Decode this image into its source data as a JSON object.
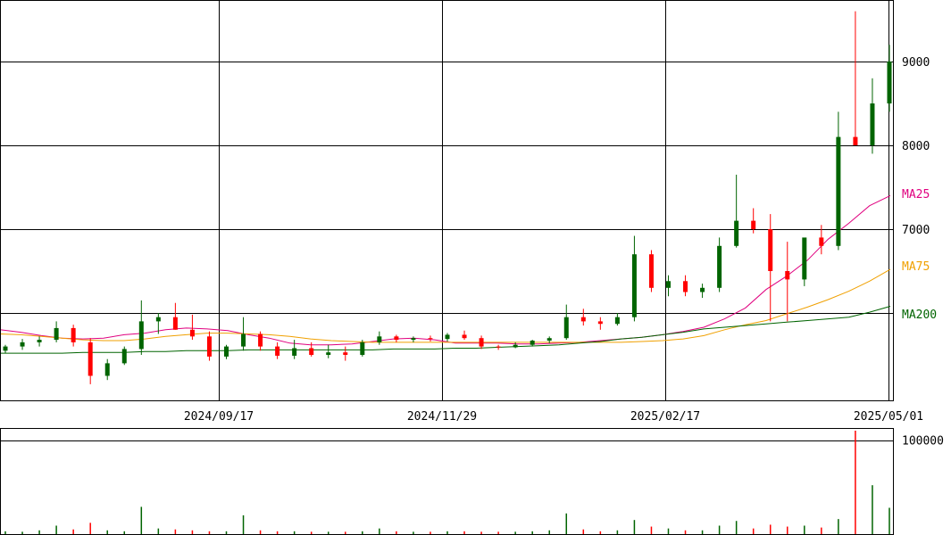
{
  "chart_data": {
    "type": "candlestick",
    "x_ticks": [
      "2024/09/17",
      "2024/11/29",
      "2025/02/17",
      "2025/05/01"
    ],
    "price_ticks": [
      9000,
      8000,
      7000
    ],
    "volume_ticks": [
      100000
    ],
    "ylim": [
      5000,
      10000
    ],
    "volume_ylim": [
      0,
      110000
    ],
    "grid": true,
    "colors": {
      "up": "#006400",
      "down": "#ff0000",
      "ma25": "#e0007f",
      "ma75": "#f0a000",
      "ma200": "#006400"
    },
    "moving_averages": [
      {
        "name": "MA25",
        "color": "#e0007f",
        "values": [
          5800,
          5770,
          5730,
          5700,
          5690,
          5700,
          5740,
          5760,
          5800,
          5820,
          5810,
          5790,
          5740,
          5700,
          5640,
          5620,
          5620,
          5630,
          5660,
          5690,
          5700,
          5680,
          5640,
          5640,
          5640,
          5630,
          5630,
          5640,
          5650,
          5670,
          5690,
          5710,
          5740,
          5780,
          5830,
          5930,
          6060,
          6280,
          6440,
          6630,
          6880,
          7070,
          7280,
          7400
        ]
      },
      {
        "name": "MA75",
        "color": "#f0a000",
        "values": [
          5750,
          5740,
          5720,
          5700,
          5680,
          5670,
          5670,
          5690,
          5720,
          5740,
          5760,
          5760,
          5750,
          5740,
          5720,
          5690,
          5670,
          5660,
          5650,
          5650,
          5650,
          5650,
          5650,
          5650,
          5650,
          5650,
          5650,
          5650,
          5650,
          5650,
          5650,
          5660,
          5670,
          5690,
          5730,
          5800,
          5860,
          5910,
          5990,
          6070,
          6160,
          6260,
          6380,
          6520
        ]
      },
      {
        "name": "MA200",
        "color": "#006400",
        "values": [
          5520,
          5520,
          5520,
          5520,
          5530,
          5530,
          5530,
          5540,
          5540,
          5550,
          5550,
          5550,
          5560,
          5560,
          5560,
          5560,
          5560,
          5560,
          5560,
          5570,
          5570,
          5570,
          5580,
          5580,
          5590,
          5600,
          5610,
          5620,
          5640,
          5660,
          5690,
          5710,
          5740,
          5770,
          5810,
          5830,
          5850,
          5870,
          5890,
          5910,
          5930,
          5950,
          6010,
          6080
        ]
      }
    ],
    "candles": [
      [
        5550,
        5620,
        5520,
        5600
      ],
      [
        5600,
        5690,
        5560,
        5650
      ],
      [
        5650,
        5720,
        5600,
        5680
      ],
      [
        5680,
        5900,
        5650,
        5820
      ],
      [
        5820,
        5860,
        5600,
        5650
      ],
      [
        5650,
        5700,
        5150,
        5250
      ],
      [
        5250,
        5450,
        5200,
        5400
      ],
      [
        5400,
        5600,
        5380,
        5570
      ],
      [
        5570,
        6150,
        5500,
        5900
      ],
      [
        5900,
        6000,
        5750,
        5950
      ],
      [
        5950,
        6120,
        5800,
        5800
      ],
      [
        5800,
        5980,
        5680,
        5720
      ],
      [
        5720,
        5780,
        5430,
        5480
      ],
      [
        5480,
        5620,
        5450,
        5600
      ],
      [
        5600,
        5950,
        5550,
        5750
      ],
      [
        5750,
        5780,
        5550,
        5600
      ],
      [
        5600,
        5650,
        5450,
        5490
      ],
      [
        5490,
        5680,
        5450,
        5580
      ],
      [
        5580,
        5650,
        5480,
        5500
      ],
      [
        5500,
        5620,
        5460,
        5530
      ],
      [
        5530,
        5600,
        5430,
        5500
      ],
      [
        5500,
        5680,
        5480,
        5650
      ],
      [
        5650,
        5780,
        5620,
        5720
      ],
      [
        5720,
        5740,
        5650,
        5680
      ],
      [
        5680,
        5720,
        5650,
        5700
      ],
      [
        5700,
        5730,
        5660,
        5690
      ],
      [
        5690,
        5760,
        5660,
        5740
      ],
      [
        5740,
        5790,
        5680,
        5700
      ],
      [
        5700,
        5730,
        5570,
        5600
      ],
      [
        5600,
        5620,
        5560,
        5590
      ],
      [
        5590,
        5650,
        5580,
        5620
      ],
      [
        5620,
        5680,
        5600,
        5670
      ],
      [
        5670,
        5720,
        5640,
        5700
      ],
      [
        5700,
        6100,
        5680,
        5950
      ],
      [
        5950,
        6050,
        5850,
        5900
      ],
      [
        5900,
        5950,
        5800,
        5870
      ],
      [
        5870,
        6000,
        5850,
        5950
      ],
      [
        5950,
        6920,
        5900,
        6700
      ],
      [
        6700,
        6750,
        6250,
        6300
      ],
      [
        6300,
        6450,
        6200,
        6380
      ],
      [
        6380,
        6450,
        6200,
        6250
      ],
      [
        6250,
        6350,
        6180,
        6300
      ],
      [
        6300,
        6900,
        6250,
        6800
      ],
      [
        6800,
        7650,
        6780,
        7100
      ],
      [
        7100,
        7250,
        6950,
        7000
      ],
      [
        7000,
        7180,
        5900,
        6500
      ],
      [
        6500,
        6850,
        5900,
        6400
      ],
      [
        6400,
        6750,
        6320,
        6900
      ],
      [
        6900,
        7050,
        6700,
        6800
      ],
      [
        6800,
        8400,
        6750,
        8100
      ],
      [
        8100,
        9600,
        8000,
        8000
      ],
      [
        8000,
        8800,
        7900,
        8500
      ],
      [
        8500,
        9200,
        8400,
        9000
      ]
    ],
    "volumes": [
      3000,
      2500,
      4000,
      9000,
      5000,
      12000,
      4000,
      3000,
      29000,
      6000,
      5000,
      4000,
      3000,
      3000,
      20000,
      4000,
      3000,
      3000,
      2500,
      2500,
      2500,
      3000,
      6000,
      3000,
      2500,
      2500,
      3000,
      3000,
      2500,
      2500,
      2500,
      3000,
      4000,
      22000,
      5000,
      3000,
      4000,
      15000,
      8000,
      6000,
      4000,
      4000,
      9000,
      14000,
      6000,
      10000,
      8000,
      9000,
      7000,
      16000,
      110000,
      52000,
      28000
    ]
  }
}
